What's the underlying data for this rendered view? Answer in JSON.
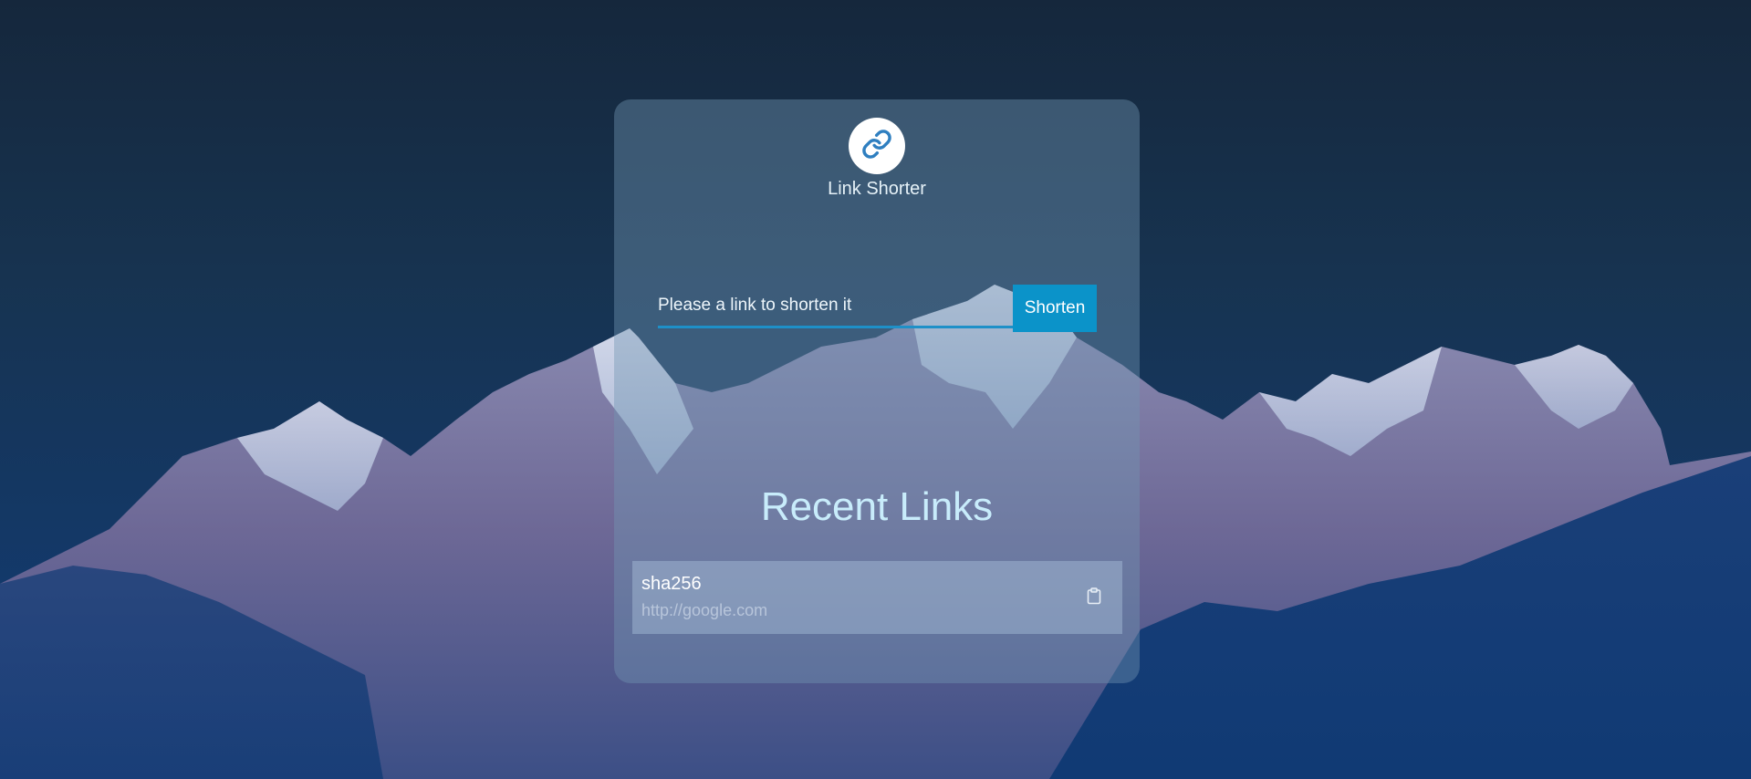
{
  "app": {
    "title": "Link Shorter",
    "logo_icon": "link-icon"
  },
  "shorten": {
    "placeholder": "Please a link to shorten it",
    "value": "",
    "button_label": "Shorten"
  },
  "recent": {
    "title": "Recent Links",
    "items": [
      {
        "hash": "sha256",
        "url": "http://google.com",
        "action_icon": "clipboard-icon"
      }
    ]
  },
  "colors": {
    "accent": "#0b93c9",
    "title_text": "#c8ecfb"
  }
}
